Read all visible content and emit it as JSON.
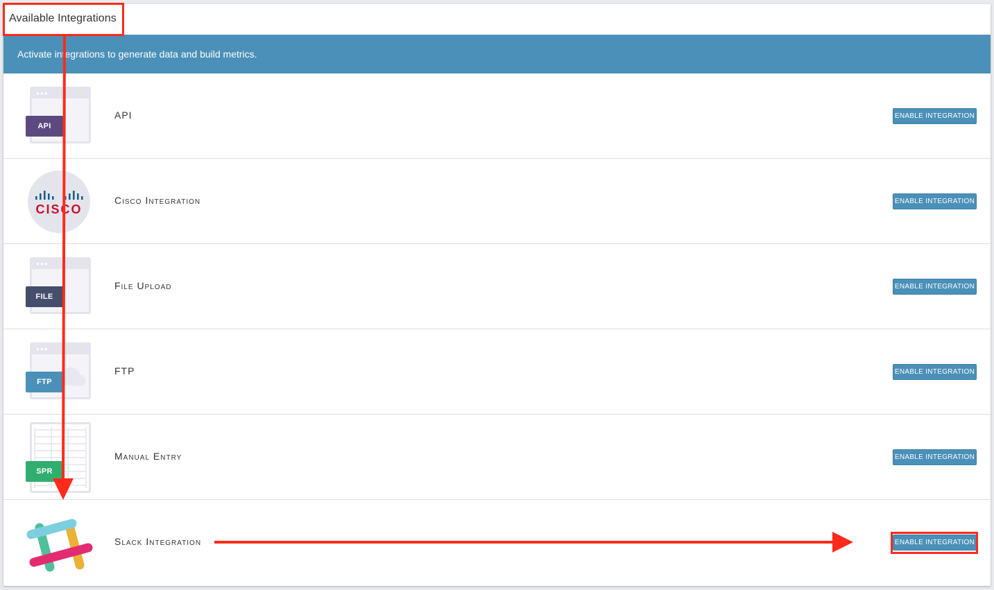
{
  "header": {
    "title": "Available Integrations"
  },
  "banner": {
    "text": "Activate integrations to generate data and build metrics."
  },
  "integrations": [
    {
      "name": "API",
      "icon": "api-icon",
      "tag": "API",
      "tag_color": "#5b4a80",
      "button": "ENABLE INTEGRATION"
    },
    {
      "name": "Cisco Integration",
      "icon": "cisco-logo-icon",
      "logo_text": "CISCO",
      "button": "ENABLE INTEGRATION"
    },
    {
      "name": "File Upload",
      "icon": "file-upload-icon",
      "tag": "FILE",
      "tag_color": "#454e6a",
      "button": "ENABLE INTEGRATION"
    },
    {
      "name": "FTP",
      "icon": "ftp-icon",
      "tag": "FTP",
      "tag_color": "#4a90b8",
      "button": "ENABLE INTEGRATION"
    },
    {
      "name": "Manual Entry",
      "icon": "spreadsheet-icon",
      "tag": "SPR",
      "tag_color": "#2fae6e",
      "button": "ENABLE INTEGRATION"
    },
    {
      "name": "Slack Integration",
      "icon": "slack-logo-icon",
      "button": "ENABLE INTEGRATION"
    }
  ],
  "colors": {
    "accent": "#4a90b8",
    "annotation": "#ff2a1a"
  }
}
